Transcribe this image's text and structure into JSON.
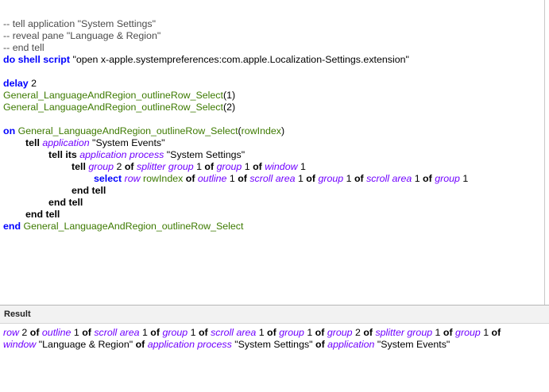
{
  "editor": {
    "c1": "-- tell application \"System Settings\"",
    "c2": "-- reveal pane \"Language & Region\"",
    "c3": "-- end tell",
    "do_shell_script": "do shell script",
    "shell_arg": " \"open x-apple.systempreferences:com.apple.Localization-Settings.extension\"",
    "delay": "delay",
    "delay_val": " 2",
    "handler": "General_LanguageAndRegion_outlineRow_Select",
    "call1_arg": "(1)",
    "call2_arg": "(2)",
    "on": "on",
    "param_open": "(",
    "param": "rowIndex",
    "param_close": ")",
    "tell": "tell",
    "tell_its": "tell its",
    "application": "application",
    "system_events": " \"System Events\"",
    "application_process": "application process",
    "system_settings": " \"System Settings\"",
    "group": "group",
    "of": "of",
    "splitter_group": "splitter group",
    "window": "window",
    "select": "select",
    "row": "row",
    "outline": "outline",
    "scroll_area": "scroll area",
    "n1": " 1 ",
    "n2": " 2 ",
    "n1_end": " 1",
    "end_tell": "end tell",
    "end": "end"
  },
  "result_panel": {
    "label": "Result",
    "row": "row",
    "n2": " 2 ",
    "of": "of",
    "outline": "outline",
    "n1": " 1 ",
    "scroll_area": "scroll area",
    "group": "group",
    "splitter_group": "splitter group",
    "window": "window",
    "lang_region": " \"Language & Region\" ",
    "application_process": "application process",
    "system_settings": " \"System Settings\" ",
    "application": "application",
    "system_events": " \"System Events\""
  }
}
